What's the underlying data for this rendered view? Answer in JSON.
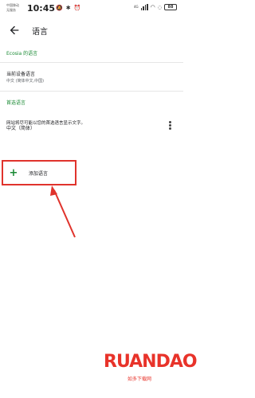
{
  "status_bar": {
    "carrier_line1": "中国移动",
    "carrier_line2": "无服务",
    "time": "10:45",
    "signal_label": "4G",
    "battery": "88"
  },
  "app_bar": {
    "title": "语言"
  },
  "sections": {
    "ecosia_title": "Ecosia 的语言",
    "device_language_title": "当前设备语言",
    "device_language_value": "中文 (简体中文,中国)",
    "preferred_title": "首选语言",
    "preferred_description": "网站将尽可能以您的首选语言显示文字。",
    "preferred_language_item": "中文（简体）",
    "add_language_label": "添加语言"
  },
  "watermark": {
    "logo": "RUANDAO",
    "subtitle": "如多下载网"
  },
  "colors": {
    "accent_green": "#1a8a34",
    "annotation_red": "#e0332c"
  }
}
